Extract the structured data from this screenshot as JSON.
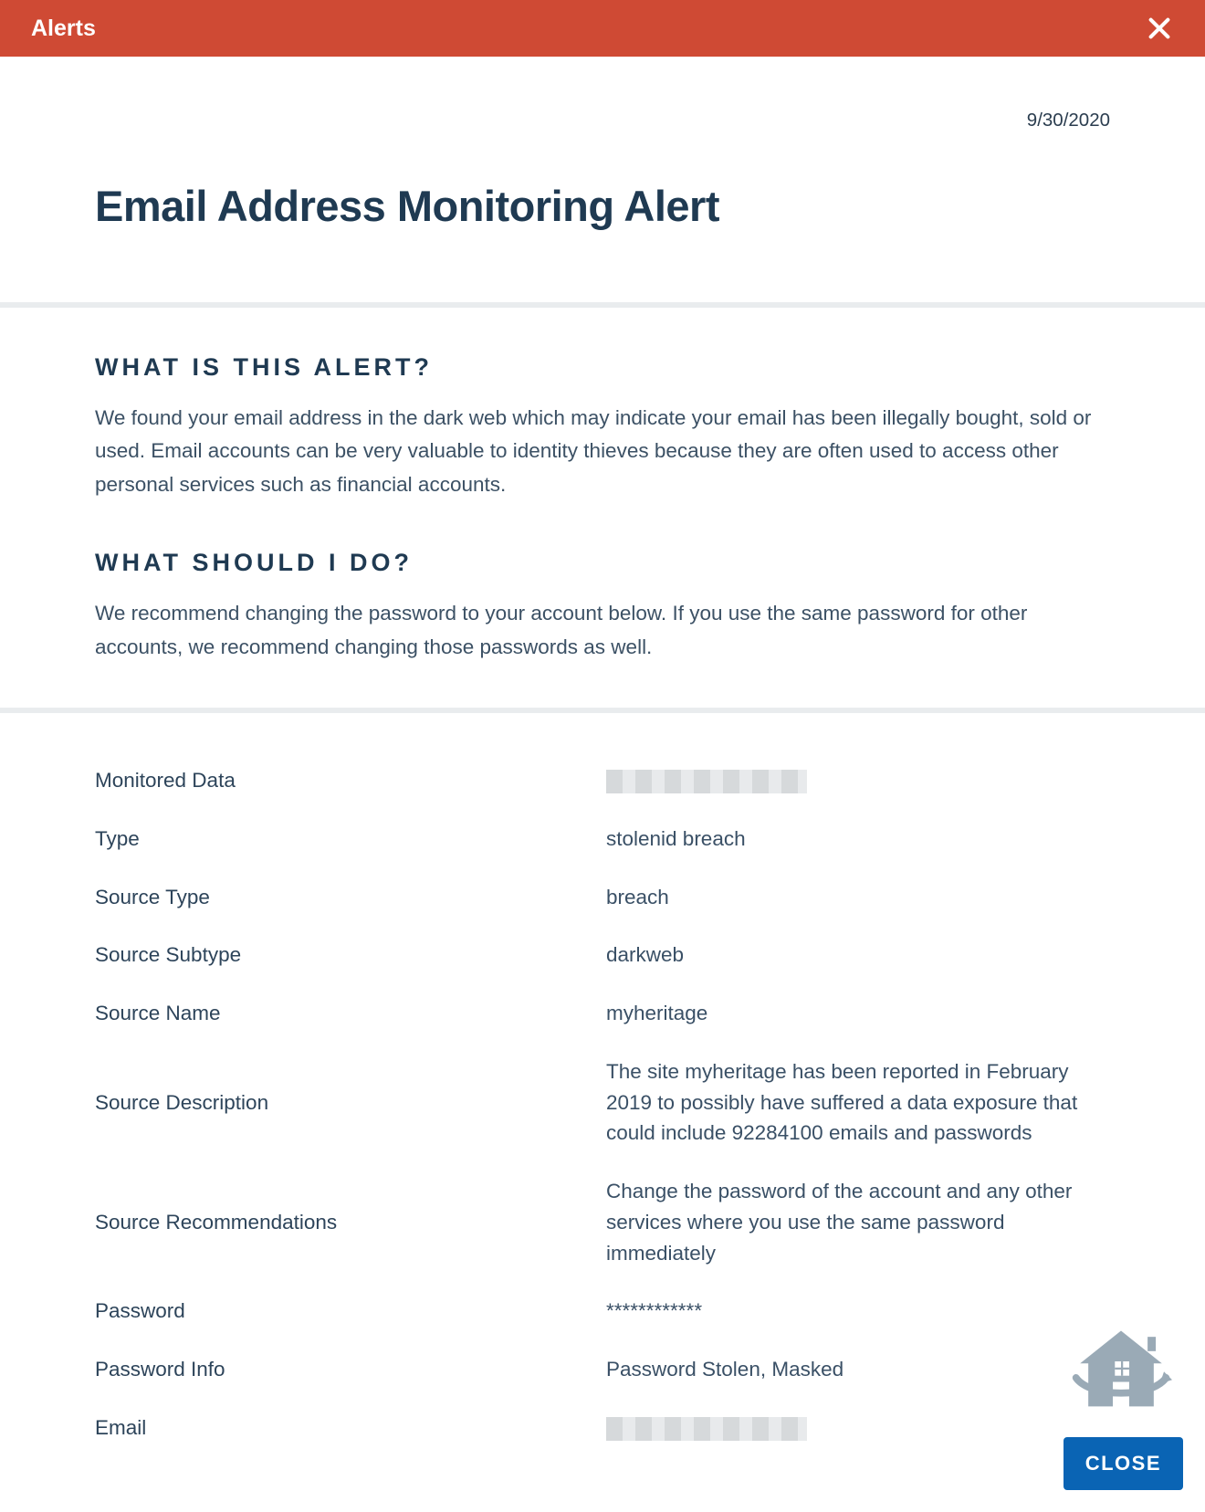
{
  "header": {
    "title": "Alerts"
  },
  "date": "9/30/2020",
  "alert_title": "Email Address Monitoring Alert",
  "sections": {
    "what_is": {
      "heading": "WHAT IS THIS ALERT?",
      "body": "We found your email address in the dark web which may indicate your email has been illegally bought, sold or used. Email accounts can be very valuable to identity thieves because they are often used to access other personal services such as financial accounts."
    },
    "what_do": {
      "heading": "WHAT SHOULD I DO?",
      "body": "We recommend changing the password to your account below. If you use the same password for other accounts, we recommend changing those passwords as well."
    }
  },
  "details": [
    {
      "label": "Monitored Data",
      "value": "",
      "redacted": true
    },
    {
      "label": "Type",
      "value": "stolenid breach"
    },
    {
      "label": "Source Type",
      "value": "breach"
    },
    {
      "label": "Source Subtype",
      "value": "darkweb"
    },
    {
      "label": "Source Name",
      "value": "myheritage"
    },
    {
      "label": "Source Description",
      "value": "The site myheritage has been reported in February 2019 to possibly have suffered a data exposure that could include 92284100 emails and passwords",
      "multiline": true
    },
    {
      "label": "Source Recommendations",
      "value": "Change the password of the account and any other services where you use the same password immediately",
      "multiline": true
    },
    {
      "label": "Password",
      "value": "************"
    },
    {
      "label": "Password Info",
      "value": "Password Stolen, Masked"
    },
    {
      "label": "Email",
      "value": "",
      "redacted": true
    }
  ],
  "close_button": "CLOSE"
}
